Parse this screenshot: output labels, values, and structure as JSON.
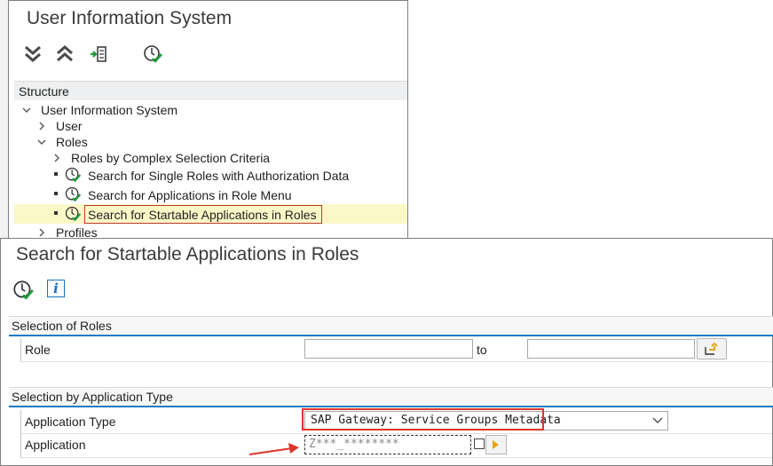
{
  "top_window": {
    "title": "User Information System",
    "toolbar_icons": [
      "expand-all-icon",
      "collapse-all-icon",
      "find-in-tree-icon",
      "execute-icon"
    ],
    "structure_header": "Structure",
    "tree": {
      "root": "User Information System",
      "user": "User",
      "roles": "Roles",
      "roles_complex": "Roles by Complex Selection Criteria",
      "single_roles_auth": "Search for Single Roles with Authorization Data",
      "apps_role_menu": "Search for Applications in Role Menu",
      "startable_apps": "Search for Startable Applications in Roles",
      "profiles": "Profiles"
    }
  },
  "bottom_window": {
    "title": "Search for Startable Applications in Roles",
    "toolbar_icons": [
      "execute-icon",
      "info-icon"
    ],
    "sections": {
      "roles_header": "Selection of Roles",
      "app_type_header": "Selection by Application Type"
    },
    "fields": {
      "role_label": "Role",
      "role_from_value": "",
      "to_label": "to",
      "role_to_value": "",
      "app_type_label": "Application Type",
      "app_type_value": "SAP Gateway: Service Groups Metadata",
      "application_label": "Application",
      "application_value": "Z***_********"
    }
  },
  "colors": {
    "selected_row": "#fbf8c8",
    "section_underline": "#1b7bc3",
    "annotation_red": "#e0342c",
    "execute_green": "#1e9b3c",
    "info_blue": "#1b6fc3"
  }
}
